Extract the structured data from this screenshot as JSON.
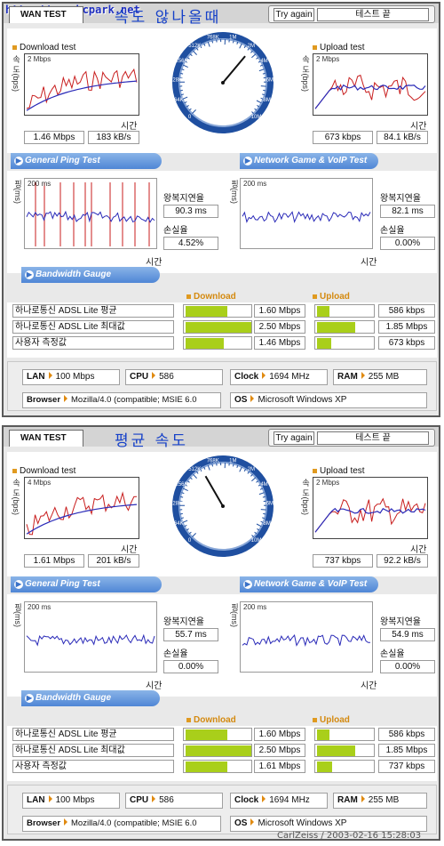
{
  "watermark": "http://www.bcpark.net",
  "footer": "CarlZeiss / 2003-02-16 15:28:03",
  "panels": [
    {
      "banner": "속도 않나올때",
      "wan_tab": "WAN TEST",
      "try_again": "Try again",
      "end_test": "테스트 끝",
      "download": {
        "title": "Download test",
        "max": "2 Mbps",
        "ylabel": "속 도(bps)",
        "xlabel": "시간",
        "mbps": "1.46 Mbps",
        "kbs": "183 kB/s"
      },
      "upload": {
        "title": "Upload test",
        "max": "2 Mbps",
        "ylabel": "속 도(bps)",
        "xlabel": "시간",
        "mbps": "673 kbps",
        "kbs": "84.1 kB/s"
      },
      "gauge_needle_deg": 40,
      "ping_band": "General Ping Test",
      "game_band": "Network Game & VoIP Test",
      "ping": {
        "max": "200 ms",
        "ylabel": "핑(ms)",
        "xlabel": "시간",
        "rtt_label": "왕복지연율",
        "rtt": "90.3 ms",
        "loss_label": "손실율",
        "loss": "4.52%"
      },
      "game": {
        "max": "200 ms",
        "ylabel": "핑(ms)",
        "xlabel": "시간",
        "rtt_label": "왕복지연율",
        "rtt": "82.1 ms",
        "loss_label": "손실율",
        "loss": "0.00%"
      },
      "bw_band": "Bandwidth Gauge",
      "bw_download": "Download",
      "bw_upload": "Upload",
      "bw_rows": [
        {
          "label": "하나로통신 ADSL Lite 평균",
          "down": "1.60 Mbps",
          "up": "586 kbps",
          "down_frac": 0.64,
          "up_frac": 0.31
        },
        {
          "label": "하나로통신 ADSL Lite 최대값",
          "down": "2.50 Mbps",
          "up": "1.85 Mbps",
          "down_frac": 1.0,
          "up_frac": 0.98
        },
        {
          "label": "사용자 측정값",
          "down": "1.46 Mbps",
          "up": "673 kbps",
          "down_frac": 0.58,
          "up_frac": 0.36
        }
      ],
      "info": {
        "lan_k": "LAN",
        "lan": "100 Mbps",
        "cpu_k": "CPU",
        "cpu": "586",
        "clock_k": "Clock",
        "clock": "1694 MHz",
        "ram_k": "RAM",
        "ram": "255 MB",
        "browser_k": "Browser",
        "browser": "Mozilla/4.0 (compatible; MSIE 6.0",
        "os_k": "OS",
        "os": "Microsoft Windows XP"
      }
    },
    {
      "banner": "평균 속도",
      "wan_tab": "WAN TEST",
      "try_again": "Try again",
      "end_test": "테스트 끝",
      "download": {
        "title": "Download test",
        "max": "4 Mbps",
        "ylabel": "속 도(bps)",
        "xlabel": "시간",
        "mbps": "1.61 Mbps",
        "kbs": "201 kB/s"
      },
      "upload": {
        "title": "Upload test",
        "max": "2 Mbps",
        "ylabel": "속 도(bps)",
        "xlabel": "시간",
        "mbps": "737 kbps",
        "kbs": "92.2 kB/s"
      },
      "gauge_needle_deg": -30,
      "ping_band": "General Ping Test",
      "game_band": "Network Game & VoIP Test",
      "ping": {
        "max": "200 ms",
        "ylabel": "핑(ms)",
        "xlabel": "시간",
        "rtt_label": "왕복지연율",
        "rtt": "55.7 ms",
        "loss_label": "손실율",
        "loss": "0.00%"
      },
      "game": {
        "max": "200 ms",
        "ylabel": "핑(ms)",
        "xlabel": "시간",
        "rtt_label": "왕복지연율",
        "rtt": "54.9 ms",
        "loss_label": "손실율",
        "loss": "0.00%"
      },
      "bw_band": "Bandwidth Gauge",
      "bw_download": "Download",
      "bw_upload": "Upload",
      "bw_rows": [
        {
          "label": "하나로통신 ADSL Lite 평균",
          "down": "1.60 Mbps",
          "up": "586 kbps",
          "down_frac": 0.64,
          "up_frac": 0.31
        },
        {
          "label": "하나로통신 ADSL Lite 최대값",
          "down": "2.50 Mbps",
          "up": "1.85 Mbps",
          "down_frac": 1.0,
          "up_frac": 0.98
        },
        {
          "label": "사용자 측정값",
          "down": "1.61 Mbps",
          "up": "737 kbps",
          "down_frac": 0.64,
          "up_frac": 0.39
        }
      ],
      "info": {
        "lan_k": "LAN",
        "lan": "100 Mbps",
        "cpu_k": "CPU",
        "cpu": "586",
        "clock_k": "Clock",
        "clock": "1694 MHz",
        "ram_k": "RAM",
        "ram": "255 MB",
        "browser_k": "Browser",
        "browser": "Mozilla/4.0 (compatible; MSIE 6.0",
        "os_k": "OS",
        "os": "Microsoft Windows XP"
      }
    }
  ],
  "gauge_labels": [
    "0",
    "64K",
    "128K",
    "256K",
    "512K",
    "768K",
    "1M",
    "2M",
    "4M",
    "6M",
    "8M",
    "10M"
  ],
  "colors": {
    "accent": "#4f86d6",
    "bar": "#a9cf1a",
    "series_red": "#c81e1e",
    "series_blue": "#2a2ab8",
    "header_orange": "#e09a20"
  }
}
